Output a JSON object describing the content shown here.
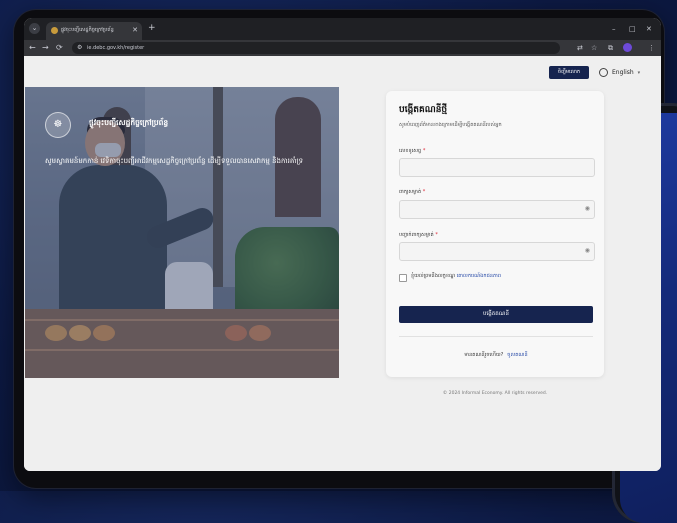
{
  "browser": {
    "tab_title": "ផ្លូវចុះបញ្ជីសេដ្ឋកិច្ចក្រៅប្រព័ន្ធ",
    "tab_close": "✕",
    "new_tab": "+",
    "search_tabs": "⌄",
    "url": "ie.debc.gov.kh/register",
    "window_minimize": "–",
    "window_maximize": "□",
    "window_close": "✕",
    "nav": {
      "back": "←",
      "forward": "→",
      "reload": "⟳"
    }
  },
  "header": {
    "top_button": "ចិញ្ចឹមលោក",
    "language": "English"
  },
  "hero": {
    "brand": "ផ្លូវចុះបញ្ជីសេដ្ឋកិច្ចក្រៅប្រព័ន្ធ",
    "description": "សូមស្វាគមន៍មកកាន់ វេទិកាចុះបញ្ជីអាជីវកម្មសេដ្ឋកិច្ចក្រៅប្រព័ន្ធ ដើម្បីទទួលបានសេវាកម្ម និងការគាំទ្រ"
  },
  "form": {
    "title": "បង្កើតគណនីថ្មី",
    "subtitle": "សូមបំពេញព័ត៌មានខាងក្រោមដើម្បីបង្កើតគណនីរបស់អ្នក",
    "fields": [
      {
        "label": "លេខទូរសព្ទ",
        "required": "*"
      },
      {
        "label": "ពាក្យសម្ងាត់",
        "required": "*"
      },
      {
        "label": "បញ្ជាក់ពាក្យសម្ងាត់",
        "required": "*"
      }
    ],
    "eye_icon": "◉",
    "agree_text": "ខ្ញុំយល់ព្រមនឹងលក្ខខណ្ឌ",
    "agree_link": "គោលការណ៍ឯកជនភាព",
    "submit": "បង្កើតគណនី",
    "have_account": "មានគណនីរួចហើយ?",
    "login_link": "ចូលគណនី"
  },
  "footer": "© 2024 Informal Economy. All rights reserved."
}
